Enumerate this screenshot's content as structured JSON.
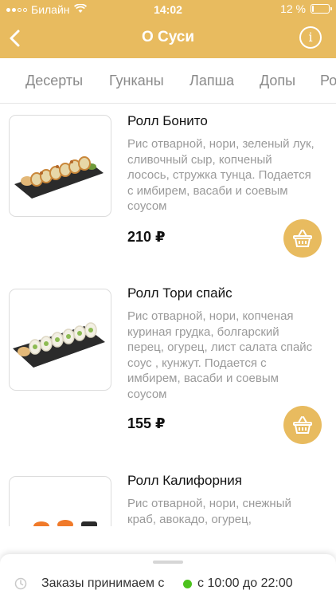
{
  "status_bar": {
    "carrier": "Билайн",
    "time": "14:02",
    "battery_text": "12 %",
    "battery_level": 0.12
  },
  "header": {
    "title": "О Суси",
    "info_label": "i",
    "background_color": "#e8bb5f"
  },
  "categories": [
    "Десерты",
    "Гунканы",
    "Лапша",
    "Допы",
    "Ро"
  ],
  "products": [
    {
      "name": "Ролл Бонито",
      "description": "Рис отварной, нори, зеленый лук, сливочный сыр, копченый лосось, стружка тунца. Подается с имбирем, васаби и соевым соусом",
      "price": "210 ₽"
    },
    {
      "name": "Ролл Тори спайс",
      "description": "Рис отварной, нори, копченая куриная грудка, болгарский перец, огурец, лист салата спайс соус , кунжут. Подается с имбирем, васаби и соевым соусом",
      "price": "155 ₽"
    },
    {
      "name": "Ролл Калифорния",
      "description": "Рис отварной, нори, снежный краб, авокадо, огурец,",
      "price": ""
    }
  ],
  "bottom_bar": {
    "hours_label": "Заказы принимаем с",
    "hours_range": "с 10:00 до 22:00",
    "status_color": "#4cc21d"
  },
  "icons": [
    "back-icon",
    "info-icon",
    "basket-icon",
    "clock-icon",
    "wifi-icon",
    "battery-icon"
  ]
}
